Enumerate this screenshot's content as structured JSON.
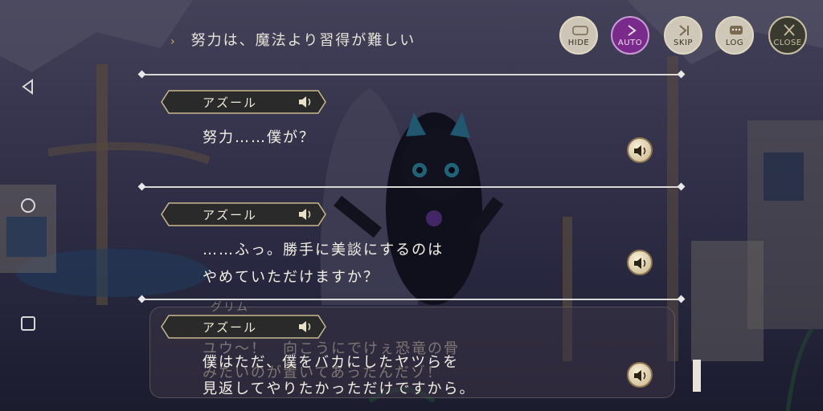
{
  "choice": {
    "arrow": "›",
    "text": "努力は、魔法より習得が難しい"
  },
  "controls": [
    {
      "key": "hide",
      "label": "HIDE"
    },
    {
      "key": "auto",
      "label": "AUTO",
      "color": "#7a2a8a"
    },
    {
      "key": "skip",
      "label": "SKIP"
    },
    {
      "key": "log",
      "label": "LOG"
    },
    {
      "key": "close",
      "label": "CLOSE"
    }
  ],
  "log_entries": [
    {
      "speaker": "アズール",
      "lines": [
        "努力……僕が？"
      ]
    },
    {
      "speaker": "アズール",
      "lines": [
        "……ふっ。勝手に美談にするのは",
        "やめていただけますか？"
      ]
    },
    {
      "speaker": "アズール",
      "lines": [
        "僕はただ、僕をバカにしたヤツらを",
        "見返してやりたかっただけですから。"
      ]
    }
  ],
  "background_dialogue": {
    "speaker": "グリム",
    "lines": [
      "ユウ〜！　向こうにでけぇ恐竜の骨",
      "みたいのが置いてあったんだゾ！"
    ]
  },
  "colors": {
    "accent": "#d8b46a",
    "auto": "#7a2a8a"
  }
}
